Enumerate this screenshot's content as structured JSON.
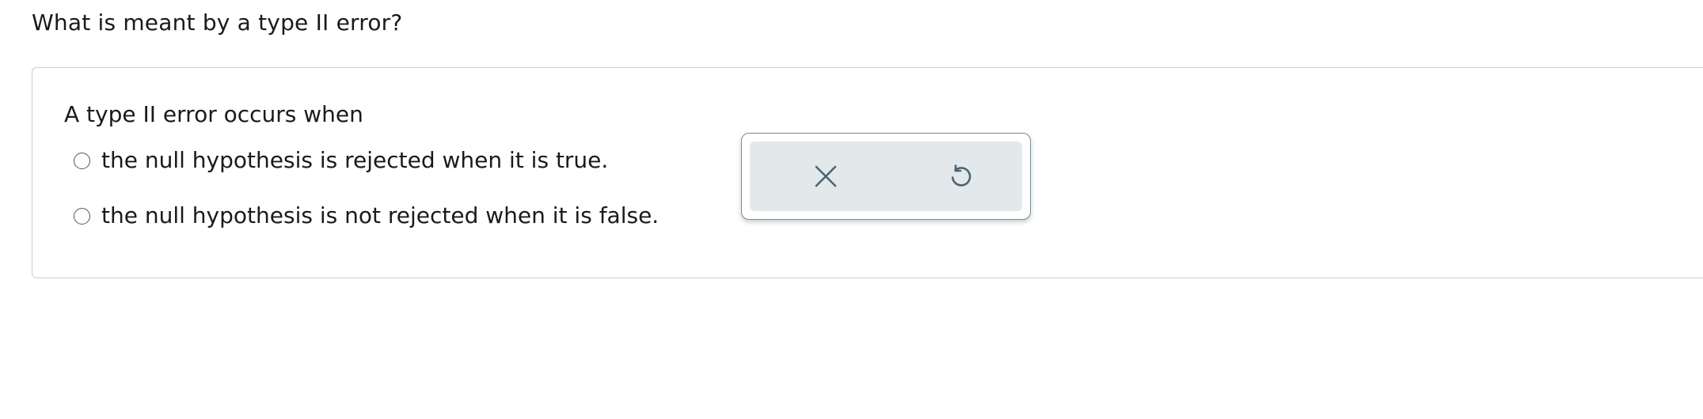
{
  "question": {
    "text": "What is meant by a type II error?"
  },
  "answer": {
    "prompt": "A type II error occurs when",
    "options": [
      {
        "label": "the null hypothesis is rejected when it is true.",
        "selected": false
      },
      {
        "label": "the null hypothesis is not rejected when it is false.",
        "selected": false
      }
    ]
  },
  "tools": {
    "buttons": [
      {
        "icon": "close-icon",
        "action": "clear"
      },
      {
        "icon": "undo-icon",
        "action": "undo"
      }
    ],
    "icon_color": "#4a6470",
    "bar_color": "#e3e8ea"
  }
}
